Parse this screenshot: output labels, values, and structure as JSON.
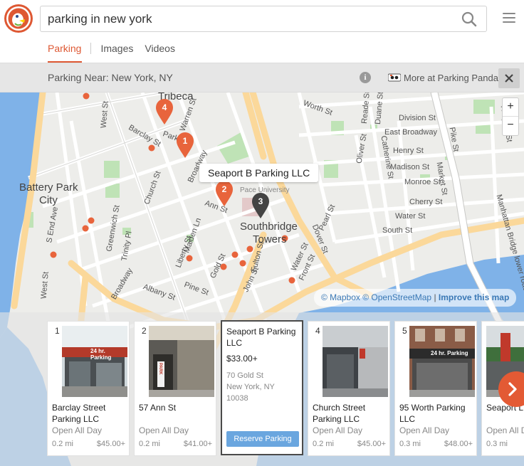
{
  "search": {
    "query": "parking in new york"
  },
  "tabs": [
    {
      "label": "Parking"
    },
    {
      "label": "Images"
    },
    {
      "label": "Videos"
    }
  ],
  "infobar": {
    "title": "Parking Near: New York, NY",
    "more_label": "More at Parking Panda",
    "info_icon": "i"
  },
  "map": {
    "labels": {
      "tribeca": "Tribeca",
      "battery_park_1": "Battery Park",
      "battery_park_2": "City",
      "southbridge_1": "Southbridge",
      "southbridge_2": "Towers",
      "pace": "Pace University",
      "worth": "Worth St",
      "reade": "Reade St",
      "duane": "Duane St",
      "division": "Division St",
      "east_broadway": "East Broadway",
      "henry": "Henry St",
      "madison": "Madison St",
      "monroe": "Monroe St",
      "cherry": "Cherry St",
      "water": "Water St",
      "south": "South St",
      "pike": "Pike St",
      "rutgers": "Rutgers St",
      "manhattan_bridge": "Manhattan Bridge lower roadway",
      "oliver": "Oliver St",
      "catherine": "Catherine St",
      "market": "Market St",
      "broadway": "Broadway",
      "broadway_2": "Broadway",
      "church": "Church St",
      "west_st": "West St",
      "greenwich": "Greenwich St",
      "trinity": "Trinity Pl",
      "barclay": "Barclay St",
      "warren": "Warren St",
      "park_pl": "Park Pl",
      "ann": "Ann St",
      "gold": "Gold St",
      "john": "John St",
      "fulton": "Fulton St",
      "pine": "Pine St",
      "liberty": "Liberty St",
      "maiden": "Maiden Ln",
      "dover": "Dover St",
      "front": "Front St",
      "water_2": "Water St",
      "west_thames": "West St",
      "south_end": "S End Ave",
      "albany": "Albany St",
      "pearl": "Pearl St",
      "madison_2": "Madison St"
    },
    "pins": [
      {
        "number": "4",
        "color": "#e8643c"
      },
      {
        "number": "1",
        "color": "#e8643c"
      },
      {
        "number": "2",
        "color": "#e8643c"
      },
      {
        "number": "3",
        "color": "#444444"
      }
    ],
    "tooltip": "Seaport B Parking LLC",
    "zoom_in": "+",
    "zoom_out": "−",
    "attribution": {
      "mapbox": "© Mapbox",
      "osm": "© OpenStreetMap",
      "sep": "|",
      "improve": "Improve this map"
    }
  },
  "cards": [
    {
      "number": "1",
      "name": "Barclay Street Parking LLC",
      "hours": "Open All Day",
      "distance": "0.2 mi",
      "price": "$45.00+",
      "photo_text": "24 hr. Parking"
    },
    {
      "number": "2",
      "name": "57 Ann St",
      "hours": "Open All Day",
      "distance": "0.2 mi",
      "price": "$41.00+",
      "photo_text": "PARK"
    },
    {
      "number": "3",
      "name": "Seaport B Parking LLC",
      "price": "$33.00+",
      "address": [
        "70 Gold St",
        "New York, NY",
        "10038"
      ],
      "button": "Reserve Parking"
    },
    {
      "number": "4",
      "name": "Church Street Parking LLC",
      "hours": "Open All Day",
      "distance": "0.2 mi",
      "price": "$45.00+",
      "photo_text": ""
    },
    {
      "number": "5",
      "name": "95 Worth Parking LLC",
      "hours": "Open All Day",
      "distance": "0.3 mi",
      "price": "$48.00+",
      "photo_text": "24 hr. Parking"
    },
    {
      "number": "6",
      "name": "Seaport LLC",
      "hours": "Open All Day",
      "distance": "0.3 mi",
      "price": "",
      "photo_text": ""
    }
  ],
  "colors": {
    "accent": "#de5833",
    "reserve_button": "#6aa6df",
    "water": "#7fb2e8",
    "park": "#bfe3b6",
    "highway": "#fbd89a"
  }
}
